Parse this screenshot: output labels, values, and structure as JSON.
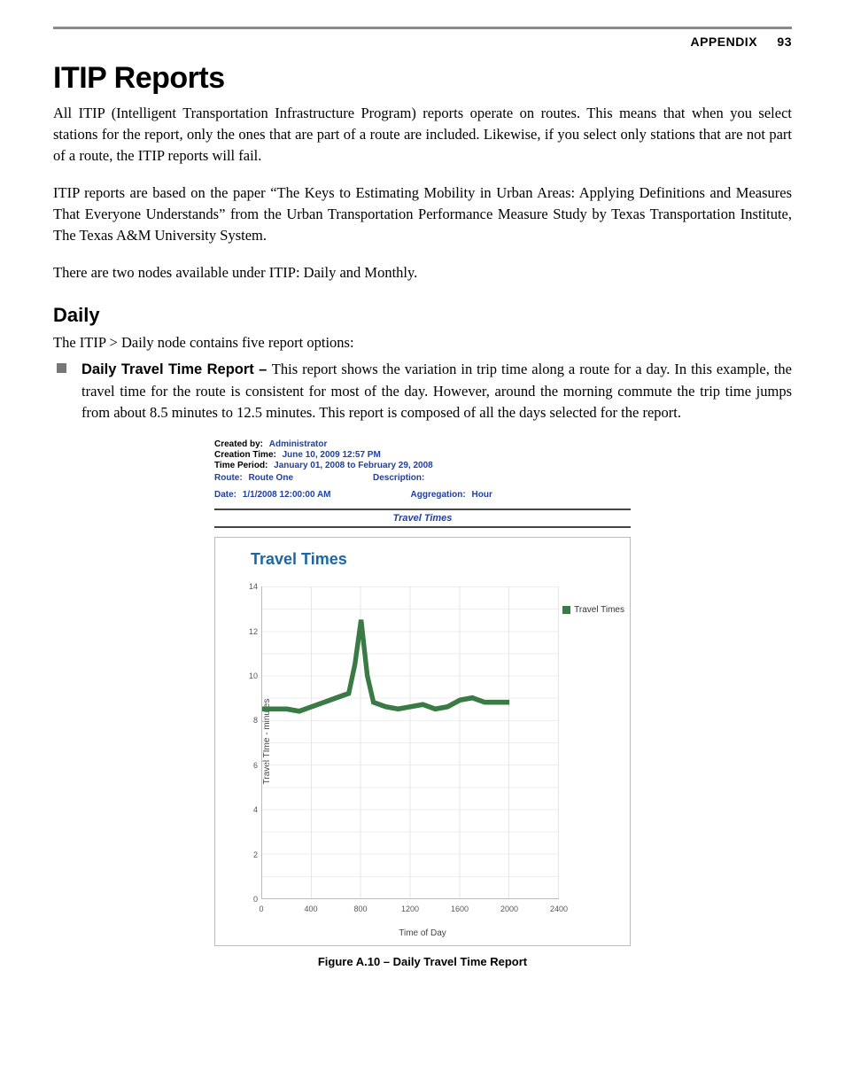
{
  "header": {
    "section": "APPENDIX",
    "page_number": "93"
  },
  "h1": "ITIP Reports",
  "para1": "All ITIP (Intelligent Transportation Infrastructure Program) reports operate on routes. This means that when you select stations for the report, only the ones that are part of a route are included. Likewise, if you select only stations that are not part of a route, the ITIP reports will fail.",
  "para2": "ITIP reports are based on the paper “The Keys to Estimating Mobility in Urban Areas: Applying Definitions and Measures That Everyone Understands” from the Urban Transportation Performance Measure Study by Texas Transportation Institute, The Texas A&M University System.",
  "para3": "There are two nodes available under ITIP: Daily and Monthly.",
  "h2": "Daily",
  "para4": "The ITIP > Daily node contains five report options:",
  "bullet": {
    "lead": "Daily Travel Time Report – ",
    "rest": "This report shows the variation in trip time along a route for a day. In this example, the travel time for the route is consistent for most of the day. However, around the morning commute the trip time jumps from about 8.5 minutes to 12.5 minutes. This report is composed of all the days selected for the report."
  },
  "report_meta": {
    "created_by_label": "Created by:",
    "created_by": "Administrator",
    "creation_time_label": "Creation Time:",
    "creation_time": "June 10, 2009 12:57 PM",
    "time_period_label": "Time Period:",
    "time_period": "January 01, 2008 to February 29, 2008",
    "route_label": "Route:",
    "route": "Route One",
    "description_label": "Description:",
    "date_label": "Date:",
    "date": "1/1/2008 12:00:00 AM",
    "aggregation_label": "Aggregation:",
    "aggregation": "Hour",
    "section_title": "Travel Times"
  },
  "chart_data": {
    "type": "line",
    "title": "Travel Times",
    "xlabel": "Time of Day",
    "ylabel": "Travel TIme - minutes",
    "xlim": [
      0,
      2400
    ],
    "ylim": [
      0,
      14
    ],
    "x_ticks": [
      0,
      400,
      800,
      1200,
      1600,
      2000,
      2400
    ],
    "y_ticks": [
      0,
      2,
      4,
      6,
      8,
      10,
      12,
      14
    ],
    "series": [
      {
        "name": "Travel Times",
        "color": "#3a7a45",
        "x": [
          0,
          100,
          200,
          300,
          400,
          500,
          600,
          700,
          750,
          800,
          850,
          900,
          1000,
          1100,
          1200,
          1300,
          1400,
          1500,
          1600,
          1700,
          1800,
          1900,
          2000
        ],
        "values": [
          8.5,
          8.5,
          8.5,
          8.4,
          8.6,
          8.8,
          9.0,
          9.2,
          10.5,
          12.5,
          10.0,
          8.8,
          8.6,
          8.5,
          8.6,
          8.7,
          8.5,
          8.6,
          8.9,
          9.0,
          8.8,
          8.8,
          8.8
        ]
      }
    ],
    "legend_position": "right"
  },
  "figure_caption": "Figure A.10 – Daily Travel Time Report"
}
